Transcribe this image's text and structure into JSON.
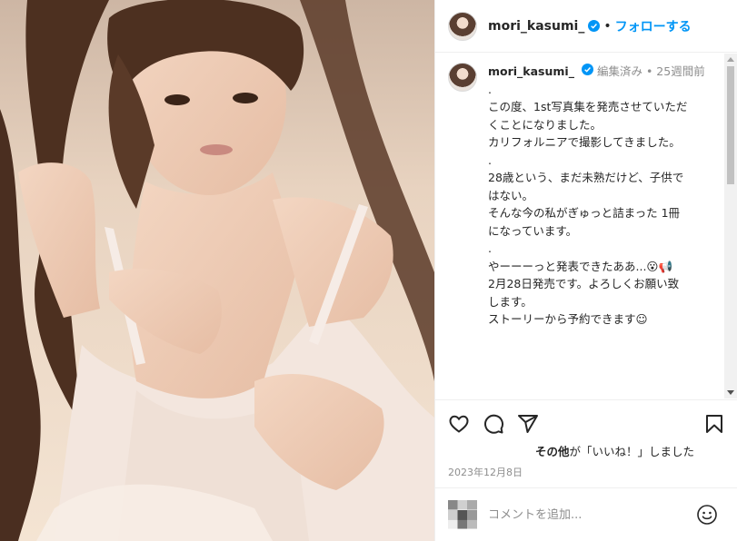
{
  "header": {
    "username": "mori_kasumi_",
    "separator": "•",
    "follow_label": "フォローする"
  },
  "caption": {
    "username": "mori_kasumi_",
    "edited": "編集済み",
    "separator": "•",
    "age": "25週間前",
    "lines": [
      ".",
      "この度、1st写真集を発売させていただ",
      "くことになりました。",
      "カリフォルニアで撮影してきました。",
      ".",
      "28歳という、まだ未熟だけど、子供で",
      "はない。",
      "そんな今の私がぎゅっと詰まった 1冊",
      "になっています。",
      ".",
      "やーーーっと発表できたああ...😮📢",
      "2月28日発売です。よろしくお願い致",
      "します。",
      "ストーリーから予約できます☺"
    ]
  },
  "actions": {
    "icons": [
      "heart-icon",
      "comment-icon",
      "share-icon",
      "bookmark-icon"
    ],
    "likes_who": "その他",
    "likes_text": "が「いいね！」しました",
    "date": "2023年12月8日"
  },
  "comment": {
    "placeholder": "コメントを追加...",
    "emoji_icon": "smiley-icon"
  },
  "colors": {
    "accent": "#0095f6",
    "verified": "#0095f6",
    "muted": "#8e8e8e"
  }
}
